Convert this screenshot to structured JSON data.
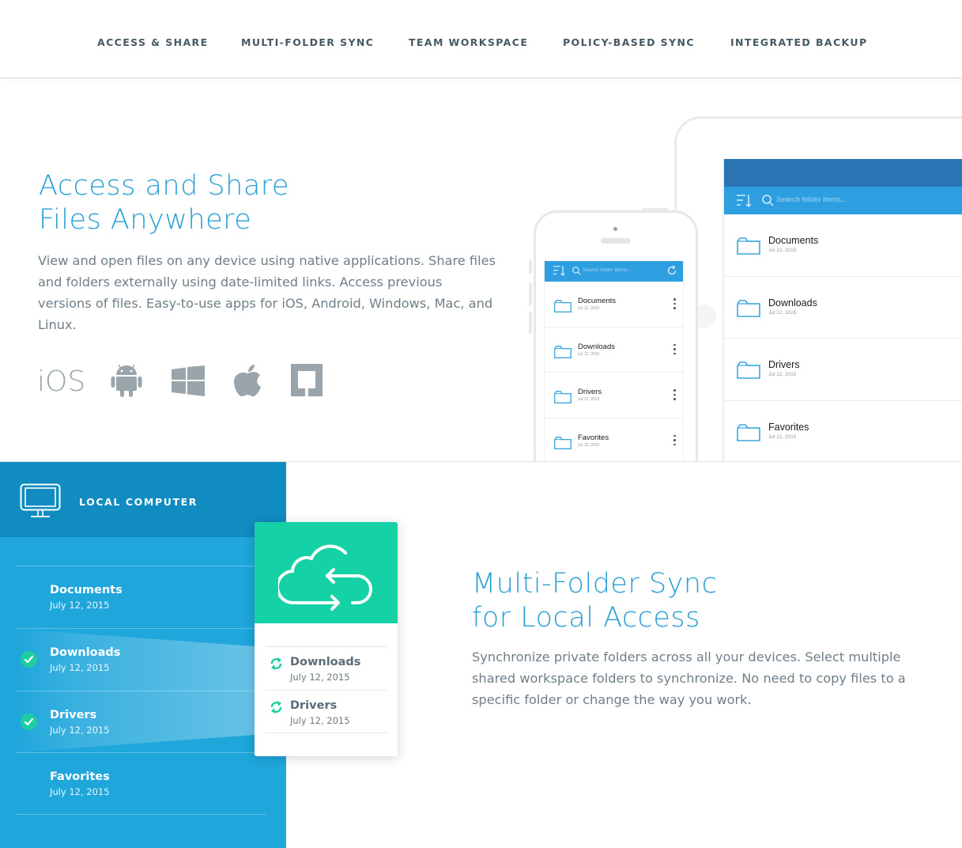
{
  "nav": {
    "items": [
      {
        "label": "ACCESS & SHARE"
      },
      {
        "label": "MULTI-FOLDER SYNC"
      },
      {
        "label": "TEAM WORKSPACE"
      },
      {
        "label": "POLICY-BASED SYNC"
      },
      {
        "label": "INTEGRATED BACKUP"
      }
    ]
  },
  "access": {
    "title_line1": "Access and Share",
    "title_line2": "Files Anywhere",
    "description": "View and open files on any device using native applications. Share files and folders externally using date-limited links. Access previous versions of files. Easy-to-use apps for iOS, Android, Windows, Mac, and Linux.",
    "platforms": [
      {
        "name": "iOS",
        "icon": "ios-icon",
        "label": "iOS"
      },
      {
        "name": "Android",
        "icon": "android-icon"
      },
      {
        "name": "Windows",
        "icon": "windows-icon"
      },
      {
        "name": "Mac",
        "icon": "apple-icon"
      },
      {
        "name": "Linux",
        "icon": "linux-icon"
      }
    ]
  },
  "tablet": {
    "search_placeholder": "Search folder items...",
    "folders": [
      {
        "name": "Documents",
        "date": "Jul 12, 2015"
      },
      {
        "name": "Downloads",
        "date": "Jul 12, 2015"
      },
      {
        "name": "Drivers",
        "date": "Jul 12, 2015"
      },
      {
        "name": "Favorites",
        "date": "Jul 12, 2015"
      }
    ]
  },
  "phone": {
    "search_placeholder": "Search folder items...",
    "folders": [
      {
        "name": "Documents",
        "date": "Jul 12, 2015"
      },
      {
        "name": "Downloads",
        "date": "Jul 12, 2015"
      },
      {
        "name": "Drivers",
        "date": "Jul 12, 2015"
      },
      {
        "name": "Favorites",
        "date": "Jul 12, 2015"
      }
    ]
  },
  "local_computer": {
    "title": "LOCAL COMPUTER",
    "folders": [
      {
        "name": "Documents",
        "date": "July 12, 2015",
        "synced": false
      },
      {
        "name": "Downloads",
        "date": "July 12, 2015",
        "synced": true
      },
      {
        "name": "Drivers",
        "date": "July 12, 2015",
        "synced": true
      },
      {
        "name": "Favorites",
        "date": "July 12, 2015",
        "synced": false
      }
    ]
  },
  "sync_card": {
    "icon": "cloud-sync-icon",
    "items": [
      {
        "name": "Downloads",
        "date": "July 12, 2015"
      },
      {
        "name": "Drivers",
        "date": "July 12, 2015"
      }
    ]
  },
  "multi_sync": {
    "title_line1": "Multi-Folder Sync",
    "title_line2": "for Local Access",
    "description": "Synchronize private folders across all your devices. Select multiple shared workspace folders to synchronize. No need to copy files to a specific folder or change the way you work."
  },
  "colors": {
    "accent": "#2a9fd6",
    "nav_text": "#455a64",
    "panel_blue": "#1fa6db",
    "panel_head": "#118cc0",
    "sync_green": "#15d1a6"
  }
}
